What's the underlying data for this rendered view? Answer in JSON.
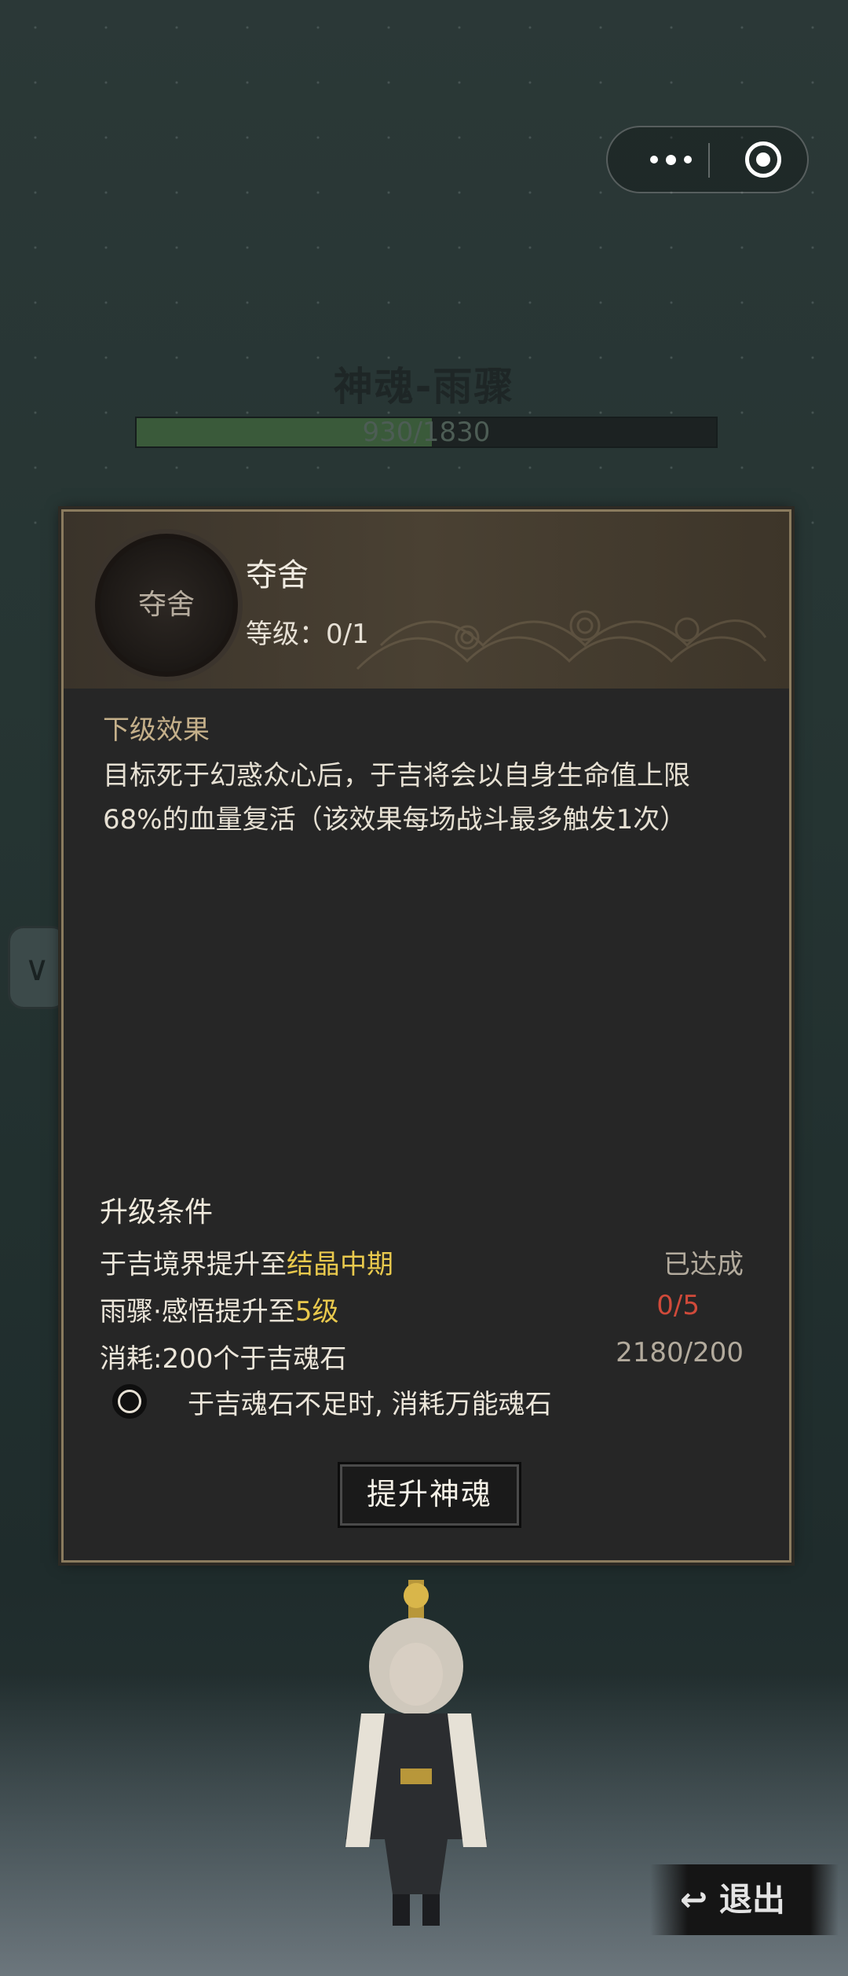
{
  "capsule": {
    "menu_icon": "more-dots-icon",
    "close_icon": "target-icon"
  },
  "background": {
    "title": "神魂-雨骤",
    "progress_text": "930/1830",
    "progress_fraction": 0.51
  },
  "dialog": {
    "skill": {
      "icon_text": "夺舍",
      "name": "夺舍",
      "level": "等级：0/1"
    },
    "effect_title": "下级效果",
    "effect_text": "目标死于幻惑众心后，于吉将会以自身生命值上限68%的血量复活（该效果每场战斗最多触发1次）",
    "upgrade_title": "升级条件",
    "conditions": [
      {
        "pre": "于吉境界提升至",
        "hl": "结晶中期",
        "status": "已达成"
      },
      {
        "pre": "雨骤·感悟提升至",
        "hl": "5级",
        "status": "0/5"
      },
      {
        "pre": "消耗:200个于吉魂石",
        "hl": "",
        "status": "2180/200"
      }
    ],
    "checkbox_label": "于吉魂石不足时, 消耗万能魂石",
    "upgrade_button": "提升神魂"
  },
  "exit_label": "退出",
  "colors": {
    "accent": "#e9c94d",
    "fail": "#d04a3a",
    "section": "#c5b08a"
  }
}
